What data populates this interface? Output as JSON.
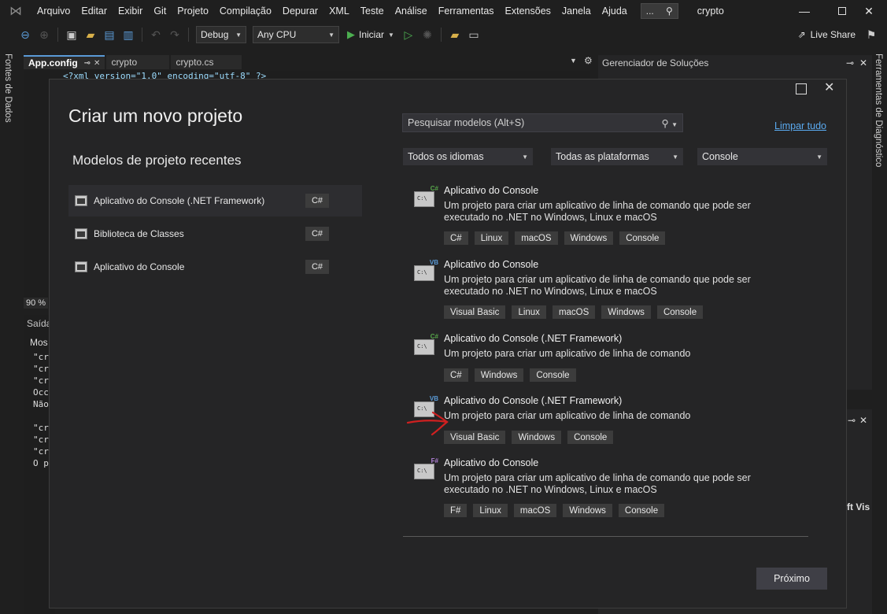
{
  "menubar": {
    "items": [
      "Arquivo",
      "Editar",
      "Exibir",
      "Git",
      "Projeto",
      "Compilação",
      "Depurar",
      "XML",
      "Teste",
      "Análise",
      "Ferramentas",
      "Extensões",
      "Janela",
      "Ajuda"
    ],
    "search_label": "...",
    "window_title": "crypto"
  },
  "toolbar": {
    "config": "Debug",
    "platform": "Any CPU",
    "start_label": "Iniciar",
    "live_share": "Live Share"
  },
  "side_left": {
    "label": "Fontes de Dados"
  },
  "side_right": {
    "label": "Ferramentas de Diagnóstico"
  },
  "editor": {
    "tabs": [
      "App.config",
      "crypto",
      "crypto.cs"
    ],
    "line1": "<?xml version=\"1.0\" encoding=\"utf-8\" ?>",
    "zoom": "90 %",
    "output_title": "Saída",
    "output_show": "Mos",
    "output_lines": [
      "\"cr",
      "\"cr",
      "\"cr",
      "Occ",
      "Não",
      "\"cr",
      "\"cr",
      "\"cr",
      "O p"
    ]
  },
  "solution_explorer": {
    "title": "Gerenciador de Soluções"
  },
  "props_panel": {
    "partial_text": "ft Vis"
  },
  "dialog": {
    "title": "Criar um novo projeto",
    "recent_heading": "Modelos de projeto recentes",
    "recent": [
      {
        "label": "Aplicativo do Console (.NET Framework)",
        "lang": "C#"
      },
      {
        "label": "Biblioteca de Classes",
        "lang": "C#"
      },
      {
        "label": "Aplicativo do Console",
        "lang": "C#"
      }
    ],
    "search_placeholder": "Pesquisar modelos (Alt+S)",
    "clear_all": "Limpar tudo",
    "filters": {
      "language": "Todos os idiomas",
      "platform": "Todas as plataformas",
      "type": "Console"
    },
    "templates": [
      {
        "name": "Aplicativo do Console",
        "lang_tag": "C#",
        "desc": "Um projeto para criar um aplicativo de linha de comando que pode ser executado no .NET no Windows, Linux e macOS",
        "tags": [
          "C#",
          "Linux",
          "macOS",
          "Windows",
          "Console"
        ]
      },
      {
        "name": "Aplicativo do Console",
        "lang_tag": "VB",
        "desc": "Um projeto para criar um aplicativo de linha de comando que pode ser executado no .NET no Windows, Linux e macOS",
        "tags": [
          "Visual Basic",
          "Linux",
          "macOS",
          "Windows",
          "Console"
        ]
      },
      {
        "name": "Aplicativo do Console (.NET Framework)",
        "lang_tag": "C#",
        "desc": "Um projeto para criar um aplicativo de linha de comando",
        "tags": [
          "C#",
          "Windows",
          "Console"
        ]
      },
      {
        "name": "Aplicativo do Console (.NET Framework)",
        "lang_tag": "VB",
        "desc": "Um projeto para criar um aplicativo de linha de comando",
        "tags": [
          "Visual Basic",
          "Windows",
          "Console"
        ]
      },
      {
        "name": "Aplicativo do Console",
        "lang_tag": "F#",
        "desc": "Um projeto para criar um aplicativo de linha de comando que pode ser executado no .NET no Windows, Linux e macOS",
        "tags": [
          "F#",
          "Linux",
          "macOS",
          "Windows",
          "Console"
        ]
      }
    ],
    "next_button": "Próximo"
  },
  "colors": {
    "accent": "#5aaaf0",
    "annotation_arrow": "#d02020",
    "csharp_tag": "#57a64a",
    "vb_tag": "#5a9ad6",
    "fsharp_tag": "#b180d7"
  }
}
